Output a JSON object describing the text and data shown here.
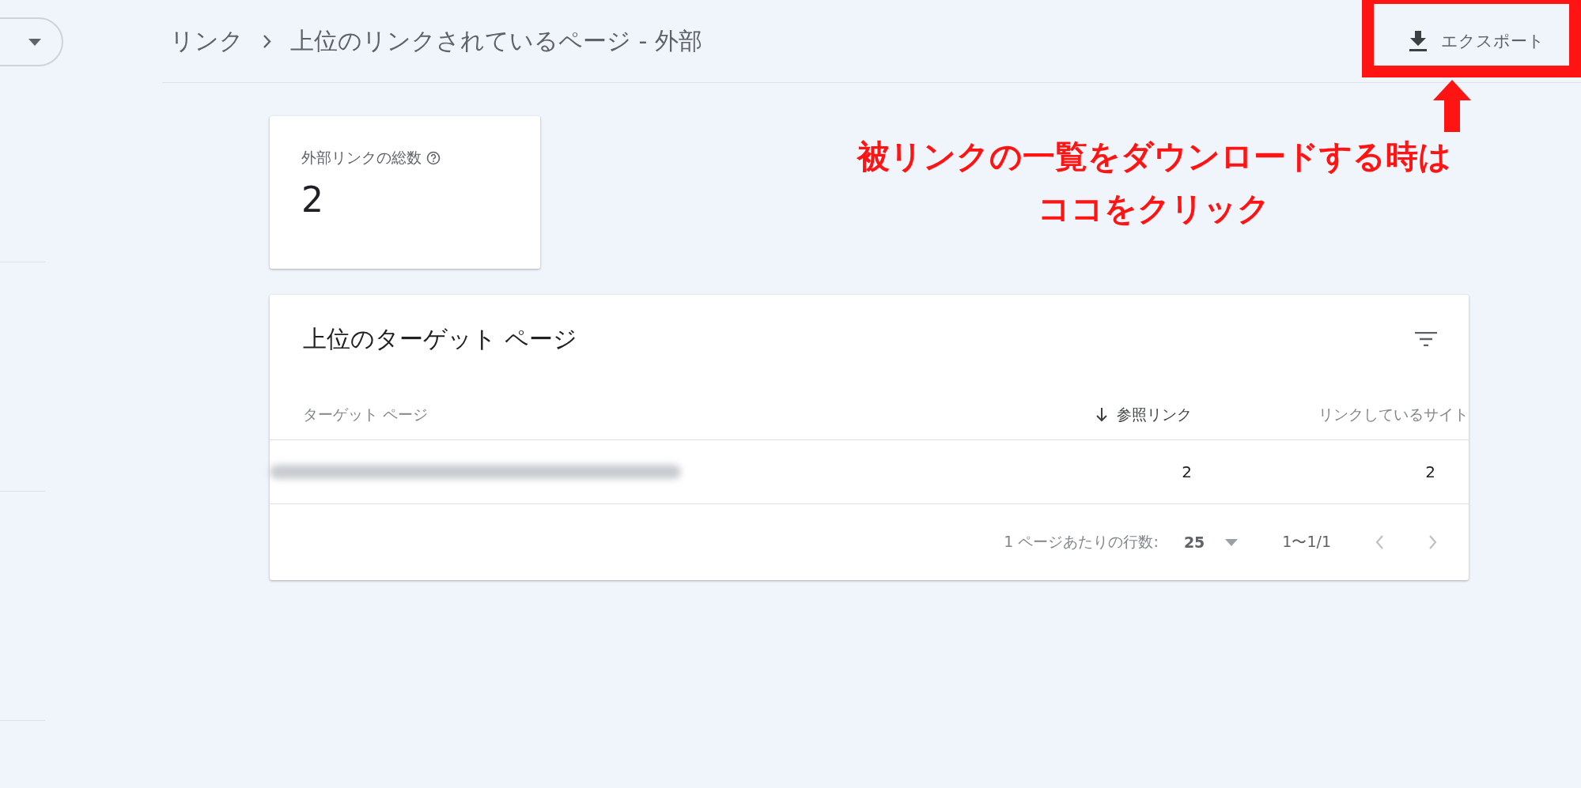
{
  "breadcrumb": {
    "items": [
      "リンク",
      "上位のリンクされているページ - 外部"
    ]
  },
  "export_button": {
    "label": "エクスポート"
  },
  "annotation": {
    "lines": [
      "被リンクの一覧をダウンロードする時は",
      "ココをクリック"
    ]
  },
  "summary_card": {
    "label": "外部リンクの総数",
    "value": "2"
  },
  "table": {
    "title": "上位のターゲット ページ",
    "columns": [
      {
        "label": "ターゲット ページ",
        "sorted": false
      },
      {
        "label": "参照リンク",
        "sorted": true
      },
      {
        "label": "リンクしているサイト",
        "sorted": false
      }
    ],
    "rows": [
      {
        "target_redacted": true,
        "links": "2",
        "sites": "2"
      }
    ],
    "rows_per_page_label": "1 ページあたりの行数:",
    "rows_per_page": "25",
    "range": "1〜1/1"
  }
}
